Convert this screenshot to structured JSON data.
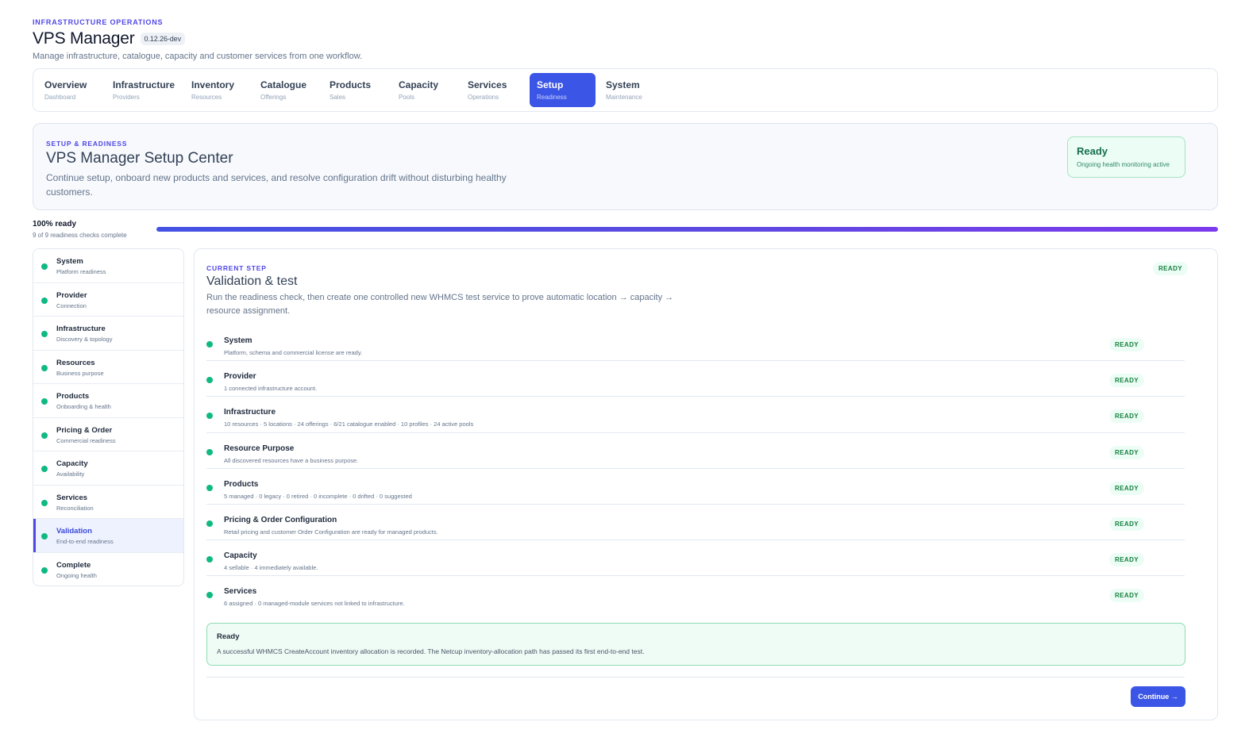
{
  "header": {
    "eyebrow": "INFRASTRUCTURE OPERATIONS",
    "title": "VPS Manager",
    "version": "0.12.26-dev",
    "subtitle": "Manage infrastructure, catalogue, capacity and customer services from one workflow."
  },
  "nav": {
    "items": [
      {
        "label": "Overview",
        "sub": "Dashboard"
      },
      {
        "label": "Infrastructure",
        "sub": "Providers"
      },
      {
        "label": "Inventory",
        "sub": "Resources"
      },
      {
        "label": "Catalogue",
        "sub": "Offerings"
      },
      {
        "label": "Products",
        "sub": "Sales"
      },
      {
        "label": "Capacity",
        "sub": "Pools"
      },
      {
        "label": "Services",
        "sub": "Operations"
      },
      {
        "label": "Setup",
        "sub": "Readiness"
      },
      {
        "label": "System",
        "sub": "Maintenance"
      }
    ],
    "active": "Setup"
  },
  "hero": {
    "eyebrow": "SETUP & READINESS",
    "title": "VPS Manager Setup Center",
    "description": "Continue setup, onboard new products and services, and resolve configuration drift without disturbing healthy customers.",
    "status_title": "Ready",
    "status_sub": "Ongoing health monitoring active"
  },
  "progress": {
    "label": "100% ready",
    "sub": "9 of 9 readiness checks complete",
    "fraction": 1.0
  },
  "steps": [
    {
      "label": "System",
      "sub": "Platform readiness"
    },
    {
      "label": "Provider",
      "sub": "Connection"
    },
    {
      "label": "Infrastructure",
      "sub": "Discovery & topology"
    },
    {
      "label": "Resources",
      "sub": "Business purpose"
    },
    {
      "label": "Products",
      "sub": "Onboarding & health"
    },
    {
      "label": "Pricing & Order",
      "sub": "Commercial readiness"
    },
    {
      "label": "Capacity",
      "sub": "Availability"
    },
    {
      "label": "Services",
      "sub": "Reconciliation"
    },
    {
      "label": "Validation",
      "sub": "End-to-end readiness"
    },
    {
      "label": "Complete",
      "sub": "Ongoing health"
    }
  ],
  "main": {
    "eyebrow": "CURRENT STEP",
    "title": "Validation & test",
    "description": "Run the readiness check, then create one controlled new WHMCS test service to prove automatic location → capacity → resource assignment.",
    "status": "READY",
    "checks": [
      {
        "label": "System",
        "desc": "Platform, schema and commercial license are ready.",
        "status": "READY"
      },
      {
        "label": "Provider",
        "desc": "1 connected infrastructure account.",
        "status": "READY"
      },
      {
        "label": "Infrastructure",
        "desc": "10 resources · 5 locations · 24 offerings · 6/21 catalogue enabled · 10 profiles · 24 active pools",
        "status": "READY"
      },
      {
        "label": "Resource Purpose",
        "desc": "All discovered resources have a business purpose.",
        "status": "READY"
      },
      {
        "label": "Products",
        "desc": "5 managed · 0 legacy · 0 retired · 0 incomplete · 0 drifted · 0 suggested",
        "status": "READY"
      },
      {
        "label": "Pricing & Order Configuration",
        "desc": "Retail pricing and customer Order Configuration are ready for managed products.",
        "status": "READY"
      },
      {
        "label": "Capacity",
        "desc": "4 sellable · 4 immediately available.",
        "status": "READY"
      },
      {
        "label": "Services",
        "desc": "6 assigned · 0 managed-module services not linked to infrastructure.",
        "status": "READY"
      }
    ],
    "result": {
      "title": "Ready",
      "text": "A successful WHMCS CreateAccount inventory allocation is recorded. The Netcup inventory-allocation path has passed its first end-to-end test."
    },
    "continue_label": "Continue →"
  },
  "colors": {
    "accent": "#3b55e6",
    "success": "#10b981",
    "eyebrow": "#4f46e5"
  }
}
